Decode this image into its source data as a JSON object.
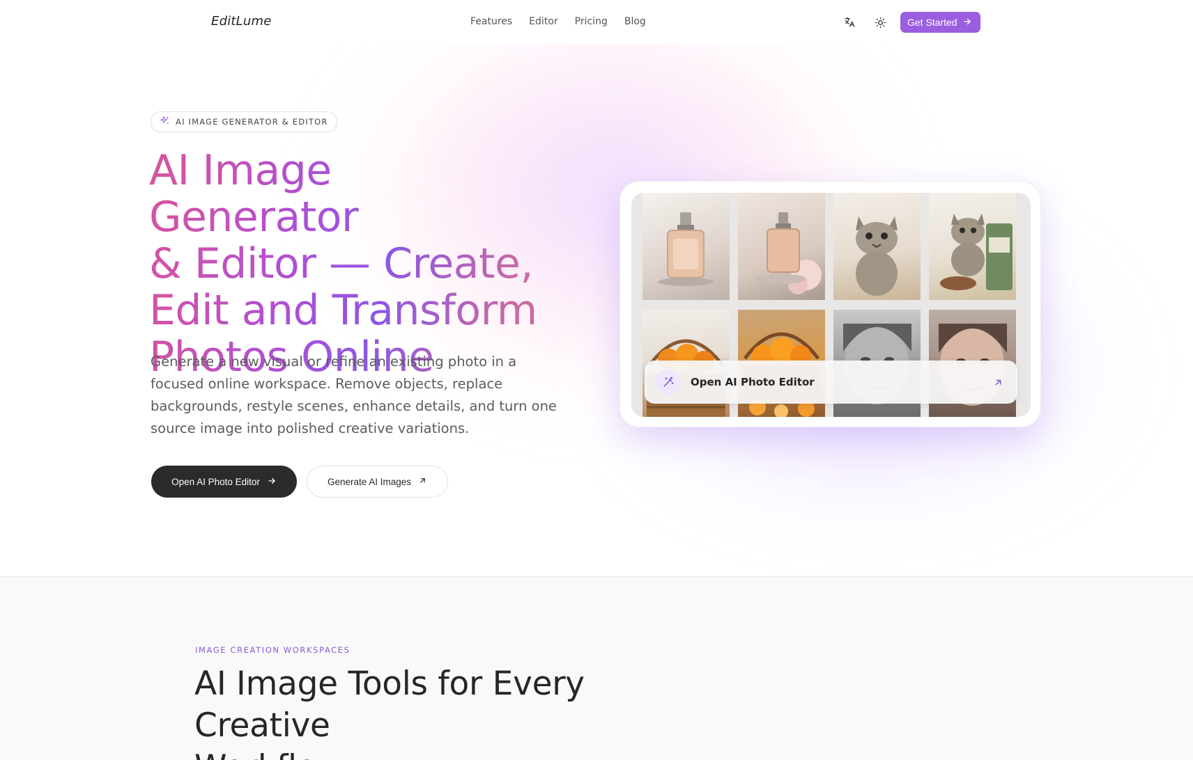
{
  "header": {
    "logo": "EditLume",
    "nav": [
      "Features",
      "Editor",
      "Pricing",
      "Blog"
    ],
    "translate_icon": "translate-icon",
    "theme_icon": "sun-icon",
    "cta_label": "Get Started"
  },
  "hero": {
    "badge": "AI IMAGE GENERATOR & EDITOR",
    "title_lines": [
      "AI Image Generator",
      "& Editor — Create,",
      "Edit and Transform",
      "Photos Online"
    ],
    "description": "Generate a new visual or refine an existing photo in a focused online workspace. Remove objects, replace backgrounds, restyle scenes, enhance details, and turn one source image into polished creative variations.",
    "primary_button": "Open AI Photo Editor",
    "secondary_button": "Generate AI Images"
  },
  "showcase": {
    "tiles": [
      "perfume-bottle",
      "perfume-bottle-with-flowers",
      "kitten",
      "kitten-with-cat-food",
      "orange-basket",
      "oranges-with-basket",
      "grayscale-portrait",
      "color-portrait"
    ],
    "cta_label": "Open AI Photo Editor"
  },
  "section": {
    "eyebrow": "IMAGE CREATION WORKSPACES",
    "title_lines": [
      "AI Image Tools for Every Creative",
      "Workflow"
    ]
  },
  "colors": {
    "accent": "#9b5ee0",
    "dark_button": "#2b2b2b",
    "gradient_pink": "#d9559a",
    "gradient_purple": "#8c57e6"
  }
}
